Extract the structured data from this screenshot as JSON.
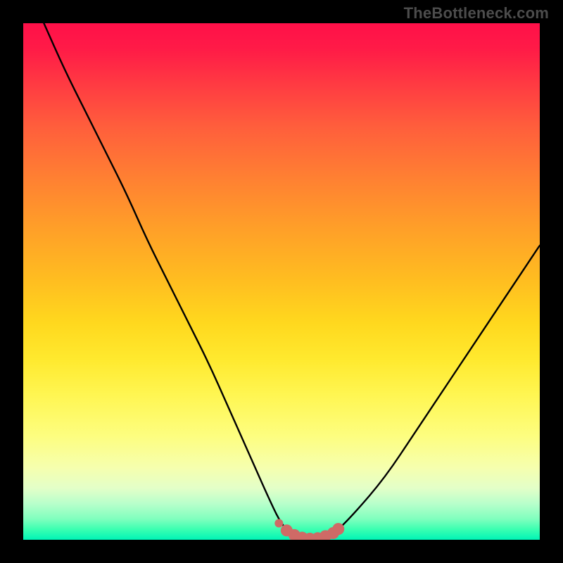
{
  "watermark": {
    "text": "TheBottleneck.com"
  },
  "colors": {
    "frame": "#000000",
    "curve": "#000000",
    "marker": "#cf6a66",
    "marker_stroke": "#cf6a66"
  },
  "chart_data": {
    "type": "line",
    "title": "",
    "xlabel": "",
    "ylabel": "",
    "xlim": [
      0,
      100
    ],
    "ylim": [
      0,
      100
    ],
    "grid": false,
    "legend": false,
    "series": [
      {
        "name": "bottleneck-curve",
        "x": [
          4,
          8,
          12,
          16,
          20,
          24,
          28,
          32,
          36,
          40,
          44,
          48,
          50,
          52,
          55,
          58,
          60,
          64,
          70,
          76,
          82,
          88,
          94,
          100
        ],
        "y": [
          100,
          91,
          83,
          75,
          67,
          58,
          50,
          42,
          34,
          25,
          16,
          7,
          3,
          1,
          0,
          0,
          1,
          5,
          12,
          21,
          30,
          39,
          48,
          57
        ]
      }
    ],
    "markers": {
      "name": "highlight-region",
      "points_xy": [
        [
          49.5,
          3.2
        ],
        [
          51.0,
          1.8
        ],
        [
          52.5,
          0.9
        ],
        [
          54.0,
          0.4
        ],
        [
          55.5,
          0.2
        ],
        [
          57.0,
          0.3
        ],
        [
          58.5,
          0.7
        ],
        [
          60.0,
          1.3
        ],
        [
          61.0,
          2.1
        ]
      ]
    }
  }
}
